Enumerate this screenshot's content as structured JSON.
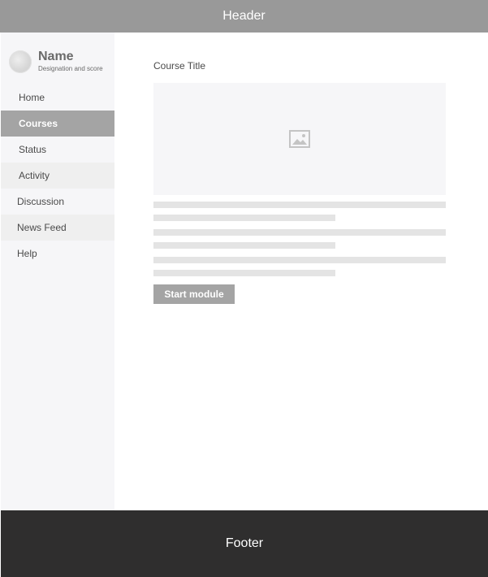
{
  "header": {
    "title": "Header"
  },
  "profile": {
    "name": "Name",
    "subtitle": "Designation and score",
    "avatar_icon": "avatar-icon"
  },
  "sidebar": {
    "items": [
      {
        "label": "Home",
        "active": false
      },
      {
        "label": "Courses",
        "active": true
      },
      {
        "label": "Status",
        "active": false
      },
      {
        "label": "Activity",
        "active": false
      },
      {
        "label": "Discussion",
        "active": false
      },
      {
        "label": "News Feed",
        "active": false
      },
      {
        "label": "Help",
        "active": false
      }
    ]
  },
  "main": {
    "course_title": "Course Title",
    "image_icon": "image-icon",
    "start_button_label": "Start module"
  },
  "footer": {
    "title": "Footer"
  },
  "colors": {
    "header_bg": "#999999",
    "sidebar_bg": "#f6f6f8",
    "active_item_bg": "#a4a4a4",
    "footer_bg": "#2f2e2e",
    "placeholder_line": "#e4e4e4"
  }
}
